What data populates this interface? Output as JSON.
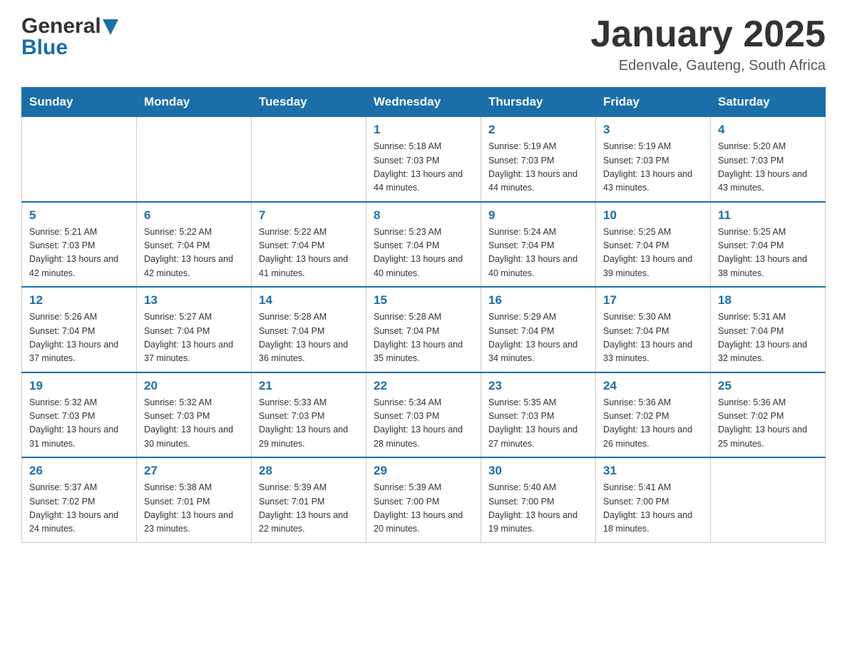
{
  "header": {
    "logo_general": "General",
    "logo_blue": "Blue",
    "title": "January 2025",
    "subtitle": "Edenvale, Gauteng, South Africa"
  },
  "days_of_week": [
    "Sunday",
    "Monday",
    "Tuesday",
    "Wednesday",
    "Thursday",
    "Friday",
    "Saturday"
  ],
  "weeks": [
    [
      {
        "num": "",
        "info": ""
      },
      {
        "num": "",
        "info": ""
      },
      {
        "num": "",
        "info": ""
      },
      {
        "num": "1",
        "info": "Sunrise: 5:18 AM\nSunset: 7:03 PM\nDaylight: 13 hours\nand 44 minutes."
      },
      {
        "num": "2",
        "info": "Sunrise: 5:19 AM\nSunset: 7:03 PM\nDaylight: 13 hours\nand 44 minutes."
      },
      {
        "num": "3",
        "info": "Sunrise: 5:19 AM\nSunset: 7:03 PM\nDaylight: 13 hours\nand 43 minutes."
      },
      {
        "num": "4",
        "info": "Sunrise: 5:20 AM\nSunset: 7:03 PM\nDaylight: 13 hours\nand 43 minutes."
      }
    ],
    [
      {
        "num": "5",
        "info": "Sunrise: 5:21 AM\nSunset: 7:03 PM\nDaylight: 13 hours\nand 42 minutes."
      },
      {
        "num": "6",
        "info": "Sunrise: 5:22 AM\nSunset: 7:04 PM\nDaylight: 13 hours\nand 42 minutes."
      },
      {
        "num": "7",
        "info": "Sunrise: 5:22 AM\nSunset: 7:04 PM\nDaylight: 13 hours\nand 41 minutes."
      },
      {
        "num": "8",
        "info": "Sunrise: 5:23 AM\nSunset: 7:04 PM\nDaylight: 13 hours\nand 40 minutes."
      },
      {
        "num": "9",
        "info": "Sunrise: 5:24 AM\nSunset: 7:04 PM\nDaylight: 13 hours\nand 40 minutes."
      },
      {
        "num": "10",
        "info": "Sunrise: 5:25 AM\nSunset: 7:04 PM\nDaylight: 13 hours\nand 39 minutes."
      },
      {
        "num": "11",
        "info": "Sunrise: 5:25 AM\nSunset: 7:04 PM\nDaylight: 13 hours\nand 38 minutes."
      }
    ],
    [
      {
        "num": "12",
        "info": "Sunrise: 5:26 AM\nSunset: 7:04 PM\nDaylight: 13 hours\nand 37 minutes."
      },
      {
        "num": "13",
        "info": "Sunrise: 5:27 AM\nSunset: 7:04 PM\nDaylight: 13 hours\nand 37 minutes."
      },
      {
        "num": "14",
        "info": "Sunrise: 5:28 AM\nSunset: 7:04 PM\nDaylight: 13 hours\nand 36 minutes."
      },
      {
        "num": "15",
        "info": "Sunrise: 5:28 AM\nSunset: 7:04 PM\nDaylight: 13 hours\nand 35 minutes."
      },
      {
        "num": "16",
        "info": "Sunrise: 5:29 AM\nSunset: 7:04 PM\nDaylight: 13 hours\nand 34 minutes."
      },
      {
        "num": "17",
        "info": "Sunrise: 5:30 AM\nSunset: 7:04 PM\nDaylight: 13 hours\nand 33 minutes."
      },
      {
        "num": "18",
        "info": "Sunrise: 5:31 AM\nSunset: 7:04 PM\nDaylight: 13 hours\nand 32 minutes."
      }
    ],
    [
      {
        "num": "19",
        "info": "Sunrise: 5:32 AM\nSunset: 7:03 PM\nDaylight: 13 hours\nand 31 minutes."
      },
      {
        "num": "20",
        "info": "Sunrise: 5:32 AM\nSunset: 7:03 PM\nDaylight: 13 hours\nand 30 minutes."
      },
      {
        "num": "21",
        "info": "Sunrise: 5:33 AM\nSunset: 7:03 PM\nDaylight: 13 hours\nand 29 minutes."
      },
      {
        "num": "22",
        "info": "Sunrise: 5:34 AM\nSunset: 7:03 PM\nDaylight: 13 hours\nand 28 minutes."
      },
      {
        "num": "23",
        "info": "Sunrise: 5:35 AM\nSunset: 7:03 PM\nDaylight: 13 hours\nand 27 minutes."
      },
      {
        "num": "24",
        "info": "Sunrise: 5:36 AM\nSunset: 7:02 PM\nDaylight: 13 hours\nand 26 minutes."
      },
      {
        "num": "25",
        "info": "Sunrise: 5:36 AM\nSunset: 7:02 PM\nDaylight: 13 hours\nand 25 minutes."
      }
    ],
    [
      {
        "num": "26",
        "info": "Sunrise: 5:37 AM\nSunset: 7:02 PM\nDaylight: 13 hours\nand 24 minutes."
      },
      {
        "num": "27",
        "info": "Sunrise: 5:38 AM\nSunset: 7:01 PM\nDaylight: 13 hours\nand 23 minutes."
      },
      {
        "num": "28",
        "info": "Sunrise: 5:39 AM\nSunset: 7:01 PM\nDaylight: 13 hours\nand 22 minutes."
      },
      {
        "num": "29",
        "info": "Sunrise: 5:39 AM\nSunset: 7:00 PM\nDaylight: 13 hours\nand 20 minutes."
      },
      {
        "num": "30",
        "info": "Sunrise: 5:40 AM\nSunset: 7:00 PM\nDaylight: 13 hours\nand 19 minutes."
      },
      {
        "num": "31",
        "info": "Sunrise: 5:41 AM\nSunset: 7:00 PM\nDaylight: 13 hours\nand 18 minutes."
      },
      {
        "num": "",
        "info": ""
      }
    ]
  ]
}
